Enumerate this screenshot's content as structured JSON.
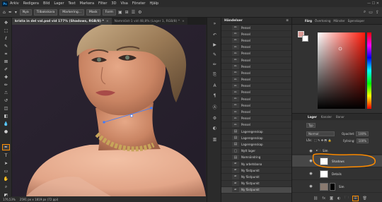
{
  "menu": [
    "Arkiv",
    "Redigera",
    "Bild",
    "Lager",
    "Text",
    "Markera",
    "Filter",
    "3D",
    "Visa",
    "Fönster",
    "Hjälp"
  ],
  "options": {
    "mode_btn": "Nya",
    "feather_btn": "Tilbakskara",
    "select_btn": "Markering...",
    "mask_btn": "Mask",
    "custom_btn": "Form",
    "reset": "0 px"
  },
  "tabs": [
    {
      "label": "krista in del val.psd vid 177% (Shadows, RGB/8) *"
    },
    {
      "label": "Namnlöst-1 vid 48,8% (Lager 1, RGB/8) *"
    }
  ],
  "status": {
    "zoom": "176,53%",
    "size": "2591 px x 1819 px (72 ppi)"
  },
  "history": {
    "title": "Händelser",
    "items": [
      "Pensel",
      "Pensel",
      "Pensel",
      "Pensel",
      "Pensel",
      "Pensel",
      "Pensel",
      "Pensel",
      "Pensel",
      "Pensel",
      "Pensel",
      "Pensel",
      "Pensel",
      "Pensel",
      "Pensel",
      "Pensel",
      "Lageregenskap",
      "Lageregenskap",
      "Lageregenskap",
      "Nytt lager",
      "Namnändring",
      "Ny arbetsbana",
      "Ny fästpunkt",
      "Ny fästpunkt",
      "Ny fästpunkt",
      "Ny fästpunkt"
    ]
  },
  "color_panel": {
    "tabs": [
      "Färg",
      "Övertoning",
      "Mönster",
      "Egenskaper"
    ]
  },
  "layers_panel": {
    "tabs": [
      "Lager",
      "Kanaler",
      "Banor"
    ],
    "kind_label": "Typ",
    "blend": "Normal",
    "opacity_label": "Opacitet:",
    "opacity": "100%",
    "lock_label": "Lås:",
    "fill_label": "Fyllning:",
    "fill": "100%",
    "layers": [
      {
        "name": "Sim"
      },
      {
        "name": "Shadows"
      },
      {
        "name": "Details"
      },
      {
        "name": "Sim"
      }
    ]
  },
  "colors": {
    "accent": "#ff8c00",
    "selected": "#4a4a4a",
    "fg": "#d99994"
  }
}
